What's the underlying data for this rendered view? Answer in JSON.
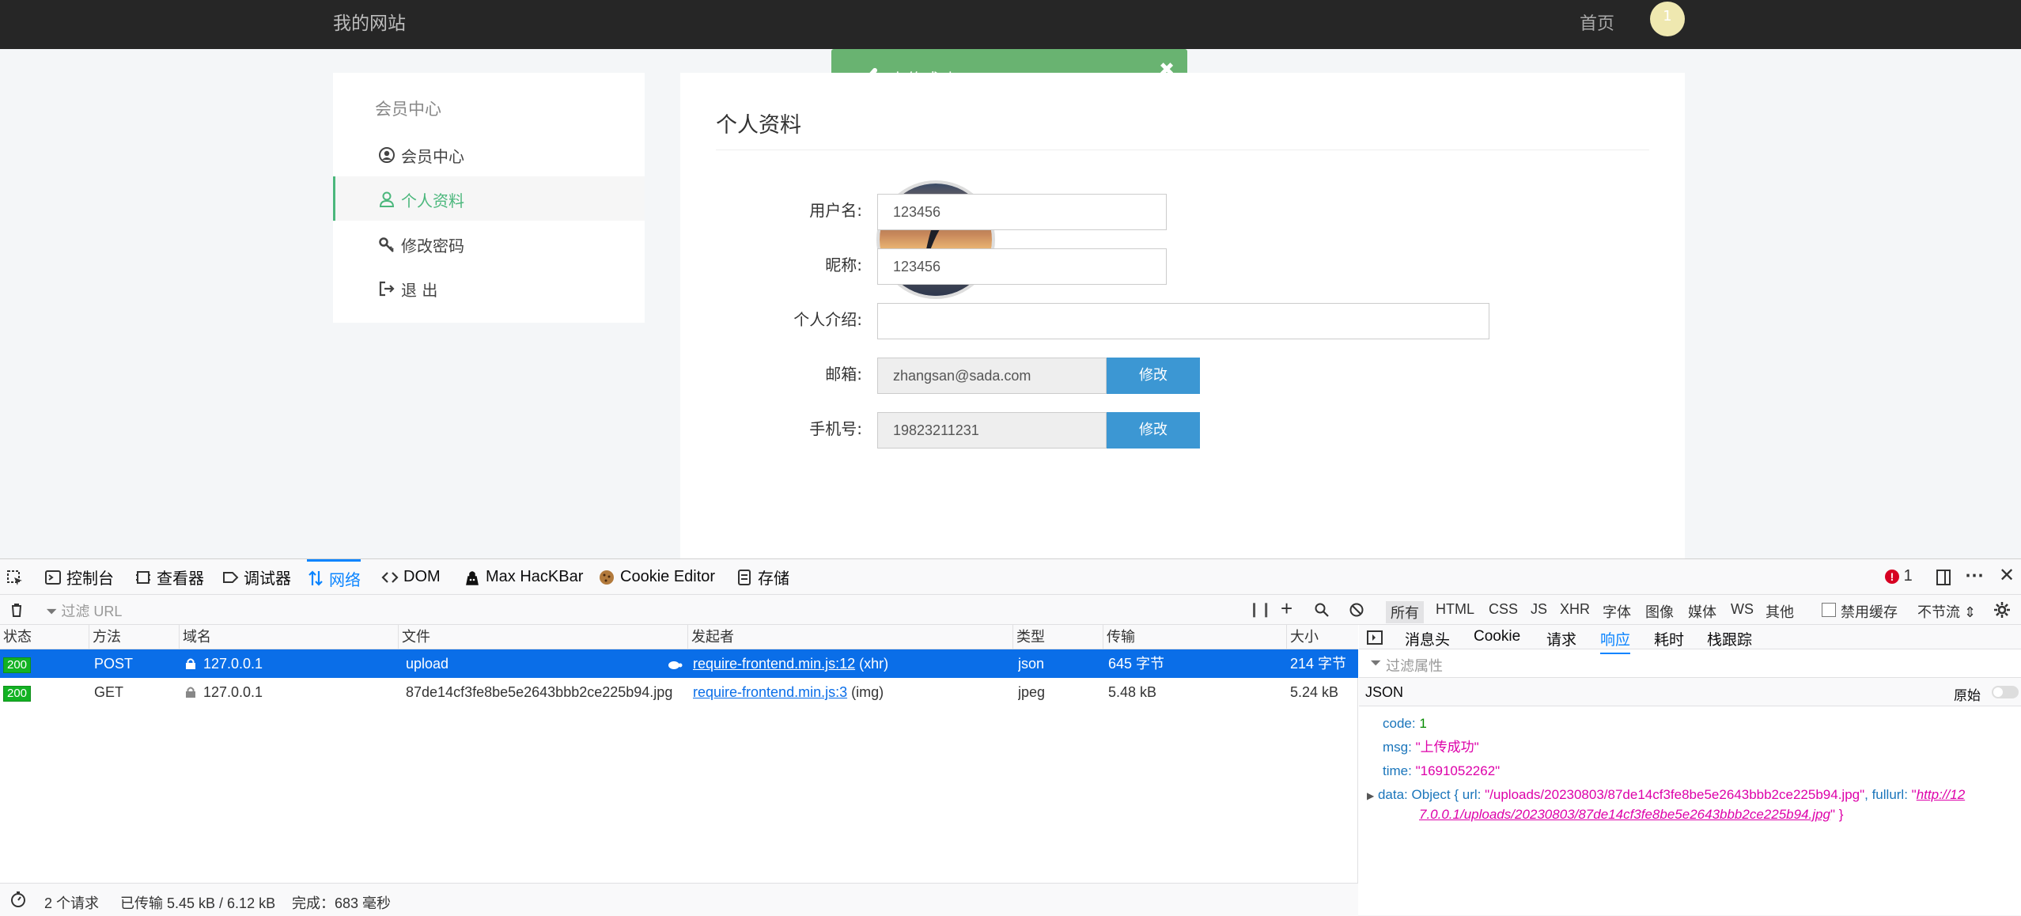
{
  "site": {
    "brand": "我的网站",
    "nav_home": "首页",
    "avatar_text": "1"
  },
  "toast": {
    "text": "上传成功"
  },
  "sidebar": {
    "title": "会员中心",
    "items": [
      {
        "label": "会员中心"
      },
      {
        "label": "个人资料"
      },
      {
        "label": "修改密码"
      },
      {
        "label": "退 出"
      }
    ]
  },
  "profile": {
    "title": "个人资料",
    "fields": {
      "username_label": "用户名:",
      "username": "123456",
      "nickname_label": "昵称:",
      "nickname": "123456",
      "bio_label": "个人介绍:",
      "bio": "",
      "email_label": "邮箱:",
      "email": "zhangsan@sada.com",
      "phone_label": "手机号:",
      "phone": "19823211231",
      "edit_btn": "修改"
    }
  },
  "devtools": {
    "tabs": [
      "控制台",
      "查看器",
      "调试器",
      "网络",
      "DOM",
      "Max HacKBar",
      "Cookie Editor",
      "存储"
    ],
    "error_count": "1",
    "filter_url": "过滤 URL",
    "type_filters": [
      "所有",
      "HTML",
      "CSS",
      "JS",
      "XHR",
      "字体",
      "图像",
      "媒体",
      "WS",
      "其他"
    ],
    "disable_cache": "禁用缓存",
    "throttle": "不节流 ⇕",
    "columns": [
      "状态",
      "方法",
      "域名",
      "文件",
      "发起者",
      "类型",
      "传输",
      "大小"
    ],
    "requests": [
      {
        "status": "200",
        "method": "POST",
        "domain": "127.0.0.1",
        "file": "upload",
        "initiator": "require-frontend.min.js:12",
        "initiator_type": "(xhr)",
        "type": "json",
        "transfer": "645 字节",
        "size": "214 字节"
      },
      {
        "status": "200",
        "method": "GET",
        "domain": "127.0.0.1",
        "file": "87de14cf3fe8be5e2643bbb2ce225b94.jpg",
        "initiator": "require-frontend.min.js:3",
        "initiator_type": "(img)",
        "type": "jpeg",
        "transfer": "5.48 kB",
        "size": "5.24 kB"
      }
    ],
    "status": {
      "requests": "2 个请求",
      "transferred": "已传输 5.45 kB / 6.12 kB",
      "finish": "完成：683 毫秒"
    },
    "detail_tabs": [
      "消息头",
      "Cookie",
      "请求",
      "响应",
      "耗时",
      "栈跟踪"
    ],
    "filter_props": "过滤属性",
    "json_label": "JSON",
    "raw_label": "原始",
    "response": {
      "code_key": "code:",
      "code": "1",
      "msg_key": "msg:",
      "msg": "\"上传成功\"",
      "time_key": "time:",
      "time": "\"1691052262\"",
      "data_key": "data:",
      "data_obj": "Object { url: ",
      "data_url": "\"/uploads/20230803/87de14cf3fe8be5e2643bbb2ce225b94.jpg\"",
      "fullurl_key": ", fullurl: ",
      "fullurl_q": "\"",
      "fullurl_1": "http://12",
      "fullurl_2": "7.0.0.1/uploads/20230803/87de14cf3fe8be5e2643bbb2ce225b94.jpg",
      "fullurl_end": "\" }"
    }
  }
}
